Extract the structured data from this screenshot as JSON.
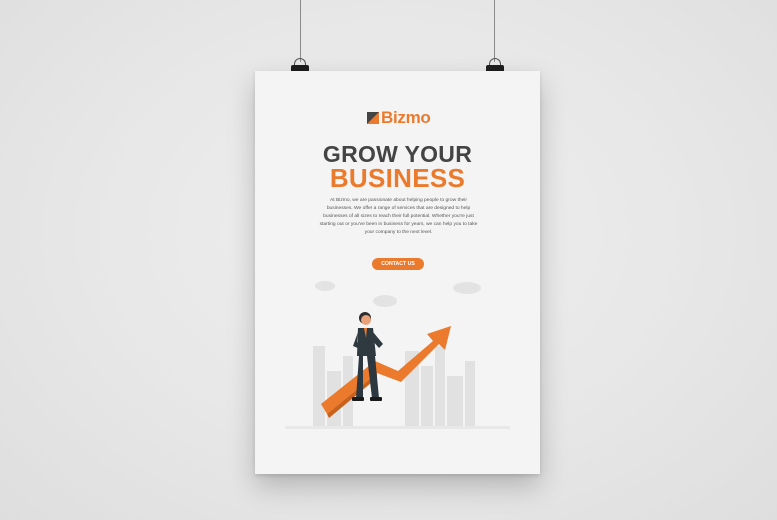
{
  "scene": {
    "background": "#e6e6e6",
    "poster_bg": "#f4f4f4",
    "accent": "#ec7a2c"
  },
  "poster": {
    "brand": "Bizmo",
    "headline_line1": "GROW YOUR",
    "headline_line2": "BUSINESS",
    "body": "At Bizmo, we are passionate about helping people to grow their businesses. We offer a range of services that are designed to help businesses of all sizes to reach their full potential. Whether you're just starting out or you've been in business for years, we can help you to take your company to the next level.",
    "cta_label": "CONTACT US"
  },
  "icons": [
    "logo-mark-icon",
    "binder-clip-icon",
    "growth-arrow-icon"
  ]
}
